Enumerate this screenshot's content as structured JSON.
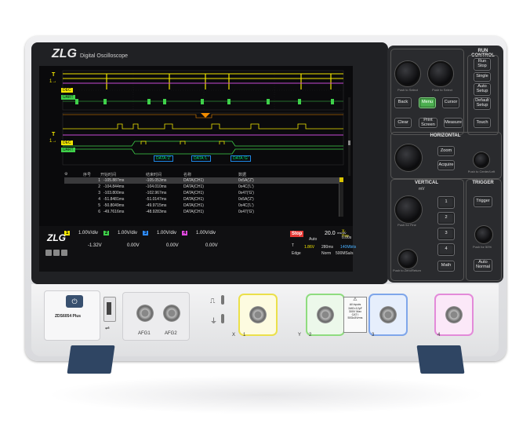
{
  "device": {
    "brand": "ZLG",
    "title": "Digital Oscilloscope",
    "model": "ZDS6054 Plus"
  },
  "top_left": {
    "push_to_select": "Push to Select"
  },
  "buttons": {
    "back": "Back",
    "menu": "Menu",
    "cursor": "Cursor",
    "clear": "Clear",
    "print_screen": "Print Screen",
    "measure": "Measure",
    "touch": "Touch",
    "zoom": "Zoom",
    "acquire": "Acquire",
    "run_stop": "Run Stop",
    "single": "Single",
    "auto_setup": "Auto Setup",
    "default_setup": "Default Setup",
    "trigger": "Trigger",
    "ch1": "1",
    "ch2": "2",
    "ch3": "3",
    "ch4": "4",
    "math": "Math",
    "auto_normal": "Auto Normal"
  },
  "sections": {
    "run_control": "RUN CONTROL",
    "horizontal": "HORIZONTAL",
    "vertical": "VERTICAL",
    "trigger": "TRIGGER"
  },
  "knob_labels": {
    "push_to_center": "Push to Center/Left",
    "push_for_fine": "Push for Fine",
    "push_to_zero": "Push to Zero/Return",
    "push_for_50": "Push for 50%",
    "mv_label": "mV"
  },
  "screen": {
    "trace_labels": [
      "T",
      "DEC",
      "UART"
    ],
    "decode_boxes": [
      "DATA:'Z'",
      "DATA:'L'",
      "DATA:'G'"
    ],
    "table": {
      "headers": [
        "序号",
        "开始时间",
        "结束时间",
        "名称",
        "数据"
      ],
      "rows": [
        [
          "1",
          "-105.887ms",
          "-105.053ms",
          "DATA(CH1)",
          "0x5A('Z')"
        ],
        [
          "2",
          "-104.844ms",
          "-104.010ms",
          "DATA(CH1)",
          "0x4C('L')"
        ],
        [
          "3",
          "-103.800ms",
          "-102.967ms",
          "DATA(CH1)",
          "0x47('G')"
        ],
        [
          "4",
          "-51.8481ms",
          "-51.0147ms",
          "DATA(CH1)",
          "0x5A('Z')"
        ],
        [
          "5",
          "-50.8049ms",
          "-49.9715ms",
          "DATA(CH1)",
          "0x4C('L')"
        ],
        [
          "6",
          "-49.7616ms",
          "-48.9283ms",
          "DATA(CH1)",
          "0x47('G')"
        ]
      ]
    },
    "bottom_logo": "ZLG",
    "channels": [
      {
        "num": "1",
        "scale": "1.00V/div",
        "offset": "-1.32V",
        "color": "#f2e600"
      },
      {
        "num": "2",
        "scale": "1.00V/div",
        "offset": "0.00V",
        "color": "#3fd14a"
      },
      {
        "num": "3",
        "scale": "1.00V/div",
        "offset": "0.00V",
        "color": "#2f8cff"
      },
      {
        "num": "4",
        "scale": "1.00V/div",
        "offset": "0.00V",
        "color": "#e04adf"
      }
    ],
    "status": {
      "stop": "Stop",
      "auto": "Auto",
      "timebase": "20.0",
      "timebase_unit": "ms/div",
      "xpos_label": "X-Pos",
      "xpos": "0.00s",
      "trig_label": "T",
      "trig_level": "1.86V",
      "srate_record": "280ms",
      "freq": "140Mbits",
      "edge": "Edge",
      "norm": "Norm",
      "sample_rate": "500MSa/s"
    }
  },
  "front": {
    "afg1": "AFG1",
    "afg2": "AFG2",
    "x": "X",
    "y": "Y",
    "ch_labels": [
      "1",
      "2",
      "3",
      "4"
    ],
    "warning": [
      "All inputs",
      "1MΩ=12pF",
      "300V Max",
      "CAT I",
      "50Ω≤5Vrms"
    ]
  },
  "colors": {
    "ch1": "#f2e600",
    "ch2": "#3fd14a",
    "ch3": "#2f8cff",
    "ch4": "#e04adf",
    "menu_btn": "#4caf50",
    "stop_badge": "#e53935"
  }
}
